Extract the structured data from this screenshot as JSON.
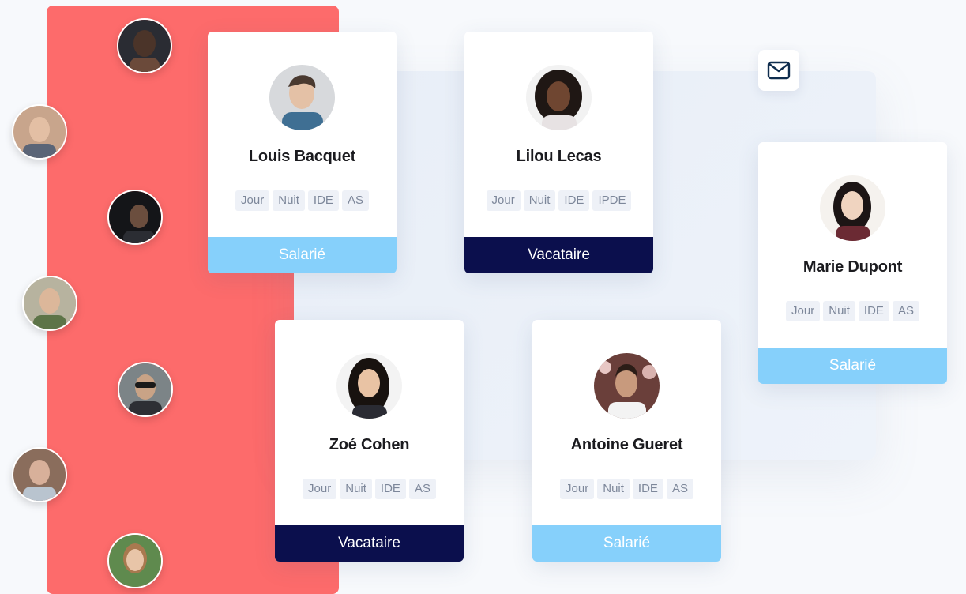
{
  "icons": {
    "mail": "mail-icon"
  },
  "colors": {
    "red_panel": "#fd6b6b",
    "salarie_bg": "#86d0fb",
    "vacataire_bg": "#0b0f4d",
    "tag_bg": "#eef1f7",
    "tag_text": "#7d879a",
    "mail_icon": "#0f2d4e"
  },
  "cards": [
    {
      "name": "Louis Bacquet",
      "tags": [
        "Jour",
        "Nuit",
        "IDE",
        "AS"
      ],
      "status": "Salarié"
    },
    {
      "name": "Lilou Lecas",
      "tags": [
        "Jour",
        "Nuit",
        "IDE",
        "IPDE"
      ],
      "status": "Vacataire"
    },
    {
      "name": "Marie Dupont",
      "tags": [
        "Jour",
        "Nuit",
        "IDE",
        "AS"
      ],
      "status": "Salarié"
    },
    {
      "name": "Zoé Cohen",
      "tags": [
        "Jour",
        "Nuit",
        "IDE",
        "AS"
      ],
      "status": "Vacataire"
    },
    {
      "name": "Antoine Gueret",
      "tags": [
        "Jour",
        "Nuit",
        "IDE",
        "AS"
      ],
      "status": "Salarié"
    }
  ]
}
